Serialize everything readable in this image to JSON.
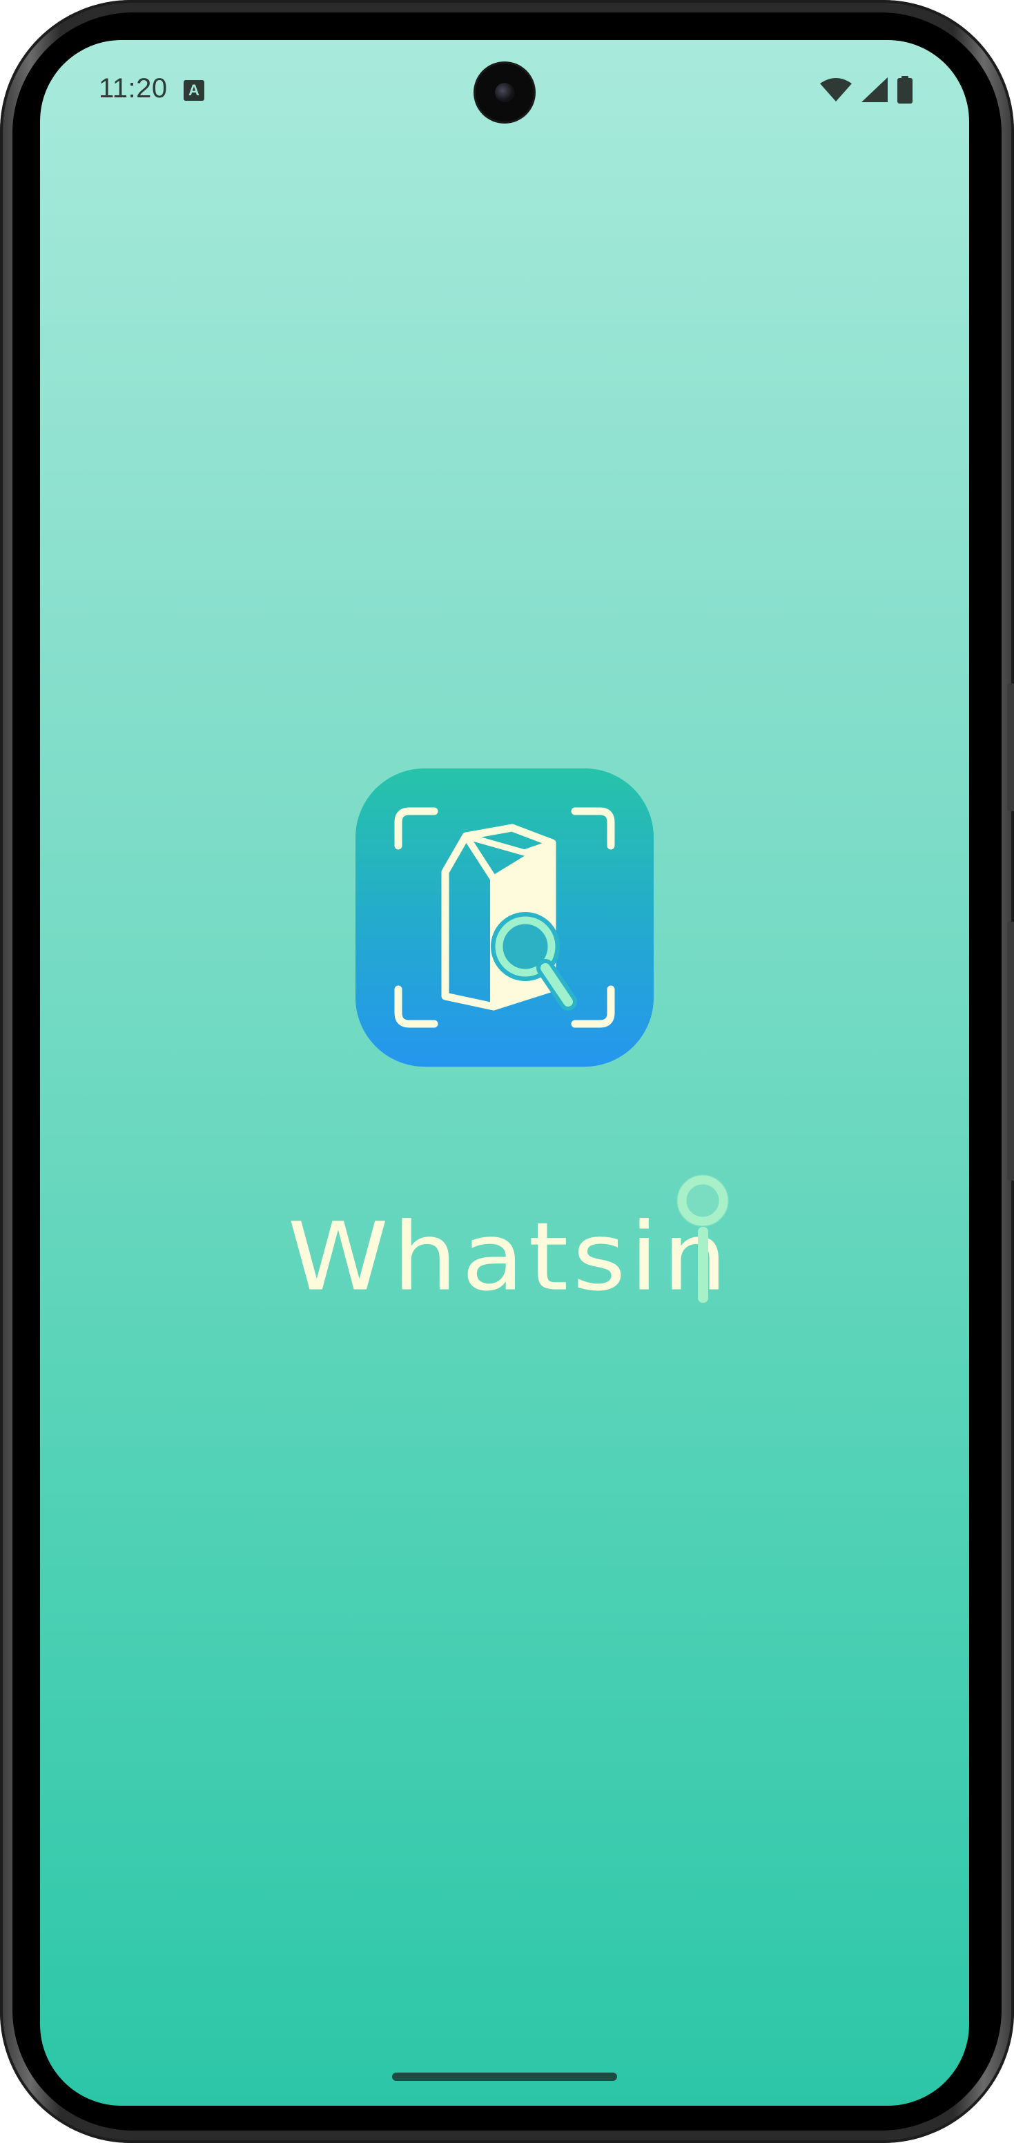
{
  "status_bar": {
    "time": "11:20",
    "notification_icon": "a-letter-icon",
    "notification_glyph": "A",
    "icons": [
      "wifi-icon",
      "cellular-signal-icon",
      "battery-icon"
    ]
  },
  "splash": {
    "logo_icon": "carton-magnifier-scan-icon",
    "app_name": "Whatsin"
  },
  "colors": {
    "background_top": "#a8eadb",
    "background_bottom": "#2cc6a7",
    "logo_gradient_top": "#27c3a9",
    "logo_gradient_bottom": "#2596ee",
    "wordmark": "#fdfbdc",
    "magnifier_accent": "#a8f0c8"
  }
}
